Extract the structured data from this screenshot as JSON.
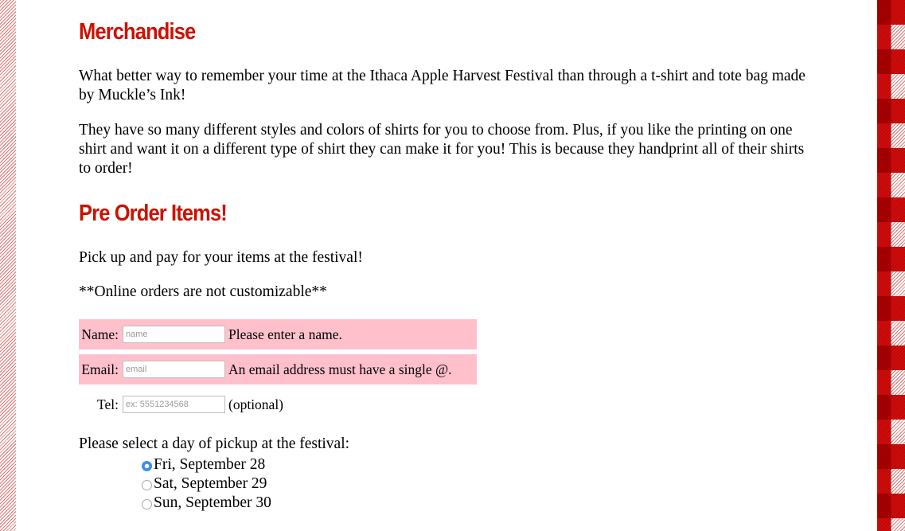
{
  "merchandise": {
    "heading": "Merchandise",
    "para1": "What better way to remember your time at the Ithaca Apple Harvest Festival than through a t-shirt and tote bag made by Muckle’s Ink!",
    "para2": "They have so many different styles and colors of shirts for you to choose from. Plus, if you like the printing on one shirt and want it on a different type of shirt they can make it for you! This is because they handprint all of their shirts to order!"
  },
  "preorder": {
    "heading": "Pre Order Items!",
    "para1": "Pick up and pay for your items at the festival!",
    "para2": "**Online orders are not customizable**"
  },
  "form": {
    "name": {
      "label": "Name:",
      "placeholder": "name",
      "message": "Please enter a name."
    },
    "email": {
      "label": "Email:",
      "placeholder": "email",
      "message": "An email address must have a single @."
    },
    "tel": {
      "label": "Tel:",
      "placeholder": "ex: 5551234568",
      "message": "(optional)"
    },
    "pickup_label": "Please select a day of pickup at the festival:",
    "pickup_options": [
      {
        "label": "Fri, September 28",
        "checked": true
      },
      {
        "label": "Sat, September 29",
        "checked": false
      },
      {
        "label": "Sun, September 30",
        "checked": false
      }
    ]
  },
  "colors": {
    "heading": "#cc1100",
    "error_bg": "#ffc0cb",
    "border_red": "#cc0000",
    "radio_selected": "#3d8ee8"
  }
}
